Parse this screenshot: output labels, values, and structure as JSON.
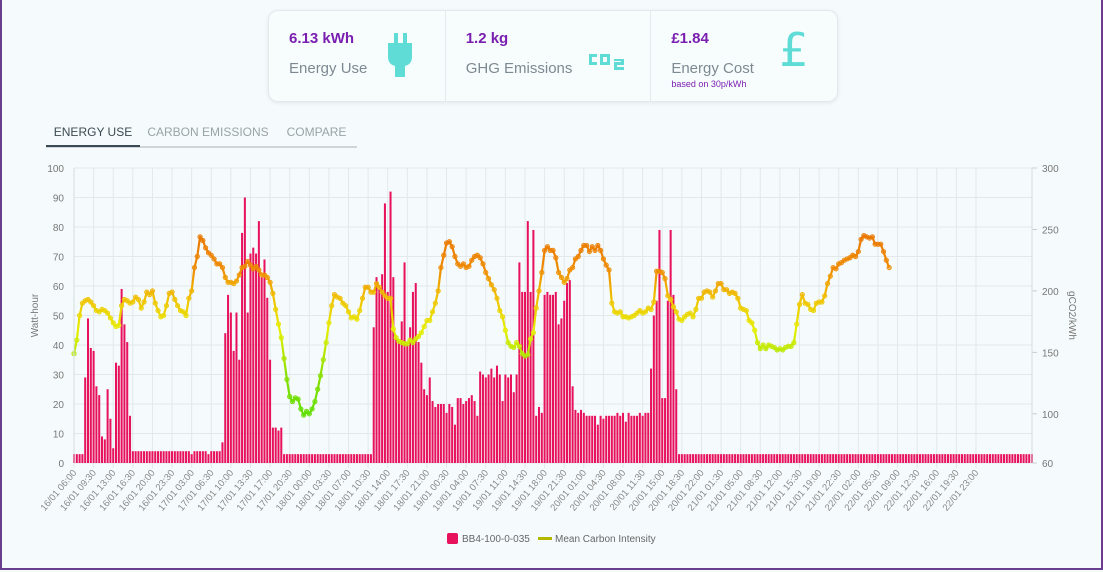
{
  "summary": {
    "energy": {
      "value": "6.13 kWh",
      "label": "Energy Use",
      "icon": "plug-icon"
    },
    "emissions": {
      "value": "1.2 kg",
      "label": "GHG Emissions",
      "icon": "co2-icon",
      "icon_text": "CO2"
    },
    "cost": {
      "value": "£1.84",
      "label": "Energy Cost",
      "note": "based on 30p/kWh",
      "icon": "pound-icon",
      "icon_text": "£"
    }
  },
  "tabs": [
    {
      "label": "ENERGY USE",
      "active": true
    },
    {
      "label": "CARBON EMISSIONS",
      "active": false
    },
    {
      "label": "COMPARE",
      "active": false
    }
  ],
  "colors": {
    "bar": "#e8115b",
    "accent": "#7a1fb0",
    "icon": "#5fdcd6"
  },
  "chart_data": {
    "type": "bar",
    "interval_minutes": 30,
    "start": "16/01 06:00",
    "end": "22/01 23:00",
    "ylabel": "Watt-hour",
    "y2label": "gCO2/kWh",
    "ylim": [
      0,
      100
    ],
    "y2lim": [
      60,
      300
    ],
    "yticks": [
      0,
      10,
      20,
      30,
      40,
      50,
      60,
      70,
      80,
      90,
      100
    ],
    "y2ticks": [
      60,
      100,
      150,
      200,
      250,
      300
    ],
    "grid": true,
    "legend_position": "bottom",
    "x_tick_labels": [
      "16/01 06:00",
      "16/01 09:30",
      "16/01 13:00",
      "16/01 16:30",
      "16/01 20:00",
      "16/01 23:30",
      "17/01 03:00",
      "17/01 06:30",
      "17/01 10:00",
      "17/01 13:30",
      "17/01 17:00",
      "17/01 20:30",
      "18/01 00:00",
      "18/01 03:30",
      "18/01 07:00",
      "18/01 10:30",
      "18/01 14:00",
      "18/01 17:30",
      "18/01 21:00",
      "19/01 00:30",
      "19/01 04:00",
      "19/01 07:30",
      "19/01 11:00",
      "19/01 14:30",
      "19/01 18:00",
      "19/01 21:30",
      "20/01 01:00",
      "20/01 04:30",
      "20/01 08:00",
      "20/01 11:30",
      "20/01 15:00",
      "20/01 18:30",
      "20/01 22:00",
      "21/01 01:30",
      "21/01 05:00",
      "21/01 08:30",
      "21/01 12:00",
      "21/01 15:30",
      "21/01 19:00",
      "21/01 22:30",
      "22/01 02:00",
      "22/01 05:30",
      "22/01 09:00",
      "22/01 12:30",
      "22/01 16:00",
      "22/01 19:30",
      "22/01 23:00"
    ],
    "series": [
      {
        "name": "BB4-100-0-035",
        "type": "bar",
        "axis": "left",
        "color": "#e8115b",
        "values": [
          3,
          3,
          3,
          3,
          29,
          49,
          39,
          38,
          26,
          23,
          9,
          8,
          25,
          15,
          5,
          34,
          33,
          59,
          47,
          41,
          16,
          4,
          4,
          4,
          4,
          4,
          4,
          4,
          4,
          4,
          4,
          4,
          4,
          4,
          4,
          4,
          4,
          4,
          4,
          4,
          4,
          4,
          3,
          4,
          4,
          4,
          4,
          4,
          3,
          4,
          4,
          4,
          4,
          7,
          44,
          57,
          51,
          38,
          51,
          35,
          78,
          90,
          51,
          71,
          73,
          71,
          82,
          63,
          69,
          56,
          35,
          12,
          12,
          11,
          12,
          3,
          3,
          3,
          3,
          3,
          3,
          3,
          3,
          3,
          3,
          3,
          3,
          3,
          3,
          3,
          3,
          3,
          3,
          3,
          3,
          3,
          3,
          3,
          3,
          3,
          3,
          3,
          3,
          3,
          3,
          3,
          3,
          46,
          63,
          59,
          64,
          88,
          58,
          92,
          63,
          43,
          41,
          48,
          68,
          40,
          46,
          58,
          61,
          41,
          34,
          25,
          23,
          29,
          21,
          19,
          20,
          20,
          20,
          17,
          20,
          19,
          13,
          22,
          22,
          20,
          21,
          22,
          23,
          21,
          16,
          31,
          30,
          29,
          30,
          32,
          29,
          33,
          30,
          21,
          30,
          29,
          30,
          24,
          30,
          68,
          58,
          58,
          82,
          58,
          79,
          16,
          19,
          17,
          57,
          58,
          57,
          57,
          58,
          47,
          49,
          55,
          61,
          62,
          26,
          18,
          17,
          18,
          17,
          16,
          16,
          16,
          16,
          13,
          16,
          15,
          16,
          16,
          16,
          16,
          17,
          16,
          17,
          14,
          17,
          16,
          16,
          16,
          17,
          16,
          17,
          17,
          32,
          50,
          55,
          79,
          22,
          22,
          55,
          79,
          57,
          25,
          3,
          3,
          3,
          3,
          3,
          3,
          3,
          3,
          3,
          3,
          3,
          3,
          3,
          3,
          3,
          3,
          3,
          3,
          3,
          3,
          3,
          3,
          3,
          3,
          3,
          3,
          3,
          3,
          3,
          3,
          3,
          3,
          3,
          3,
          3,
          3,
          3,
          3,
          3,
          3,
          3,
          3,
          3,
          3,
          3,
          3,
          3,
          3,
          3,
          3,
          3,
          3,
          3,
          3,
          3,
          3,
          3,
          3,
          3,
          3,
          3,
          3,
          3,
          3,
          3,
          3,
          3,
          3,
          3,
          3,
          3,
          3,
          3,
          3,
          3,
          3,
          3,
          3,
          3,
          3,
          3,
          3,
          3,
          3,
          3,
          3,
          3,
          3,
          3,
          3,
          3,
          3,
          3,
          3,
          3,
          3,
          3,
          3,
          3,
          3,
          3,
          3,
          3,
          3,
          3,
          3,
          3,
          3,
          3,
          3,
          3,
          3,
          3,
          3,
          3,
          3,
          3,
          3,
          3,
          3,
          3,
          3,
          3,
          3,
          3,
          3,
          3
        ]
      },
      {
        "name": "Mean Carbon Intensity",
        "type": "line",
        "axis": "right",
        "color": "#b5b800",
        "values": [
          149,
          160,
          180,
          190,
          192,
          193,
          191,
          188,
          184,
          183,
          185,
          184,
          182,
          178,
          174,
          171,
          172,
          188,
          193,
          192,
          190,
          191,
          195,
          193,
          186,
          191,
          199,
          197,
          200,
          190,
          184,
          179,
          180,
          188,
          198,
          199,
          193,
          188,
          184,
          183,
          180,
          194,
          200,
          219,
          228,
          244,
          241,
          235,
          231,
          229,
          226,
          222,
          222,
          219,
          211,
          207,
          207,
          206,
          208,
          213,
          219,
          220,
          224,
          221,
          218,
          220,
          217,
          213,
          213,
          211,
          207,
          198,
          185,
          173,
          162,
          145,
          128,
          114,
          110,
          113,
          112,
          104,
          99,
          102,
          100,
          104,
          110,
          120,
          131,
          144,
          158,
          174,
          188,
          197,
          195,
          194,
          190,
          188,
          183,
          178,
          179,
          177,
          184,
          194,
          203,
          203,
          199,
          199,
          206,
          203,
          199,
          196,
          194,
          194,
          169,
          162,
          159,
          158,
          157,
          157,
          160,
          158,
          161,
          163,
          166,
          171,
          176,
          176,
          183,
          190,
          200,
          219,
          229,
          239,
          240,
          236,
          228,
          222,
          220,
          222,
          219,
          220,
          225,
          228,
          229,
          227,
          222,
          215,
          210,
          205,
          201,
          194,
          184,
          179,
          168,
          158,
          155,
          154,
          158,
          155,
          149,
          147,
          148,
          161,
          166,
          186,
          200,
          215,
          233,
          236,
          233,
          233,
          227,
          215,
          211,
          207,
          210,
          217,
          219,
          226,
          228,
          233,
          237,
          237,
          232,
          236,
          233,
          237,
          233,
          226,
          221,
          217,
          190,
          183,
          182,
          183,
          179,
          179,
          178,
          179,
          180,
          182,
          184,
          182,
          183,
          186,
          185,
          191,
          216,
          216,
          215,
          210,
          196,
          193,
          187,
          183,
          177,
          176,
          179,
          181,
          182,
          179,
          185,
          194,
          194,
          199,
          200,
          199,
          195,
          200,
          206,
          206,
          201,
          201,
          198,
          199,
          198,
          194,
          186,
          185,
          184,
          176,
          174,
          168,
          158,
          153,
          156,
          153,
          156,
          155,
          154,
          152,
          153,
          152,
          154,
          155,
          155,
          158,
          173,
          189,
          197,
          190,
          189,
          185,
          184,
          190,
          191,
          191,
          196,
          206,
          212,
          219,
          218,
          222,
          223,
          225,
          226,
          227,
          229,
          228,
          232,
          242,
          245,
          244,
          243,
          244,
          238,
          238,
          238,
          232,
          225,
          219
        ]
      }
    ]
  }
}
